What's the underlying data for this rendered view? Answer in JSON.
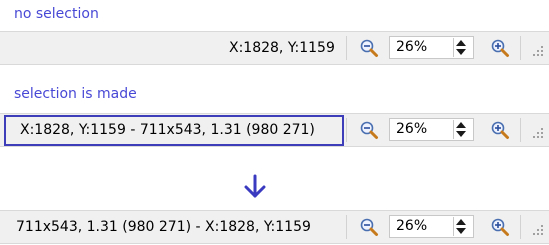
{
  "captions": {
    "no_selection": "no selection",
    "selection_made": "selection is made"
  },
  "bars": [
    {
      "status_text": "X:1828, Y:1159",
      "zoom_value": "26%"
    },
    {
      "status_text": "X:1828, Y:1159 - 711x543, 1.31 (980 271)",
      "zoom_value": "26%"
    },
    {
      "status_text": "711x543, 1.31 (980 271) -  X:1828, Y:1159",
      "zoom_value": "26%"
    }
  ],
  "colors": {
    "caption": "#4848d6",
    "highlight": "#3d3dba",
    "arrow": "#3a3ac0",
    "bar_bg": "#f0f0f0"
  },
  "icons": {
    "zoom_out": "zoom-out-icon",
    "zoom_in": "zoom-in-icon",
    "spin": "spinner-arrows-icon",
    "grip": "resize-grip-icon",
    "arrow": "arrow-down-icon"
  }
}
